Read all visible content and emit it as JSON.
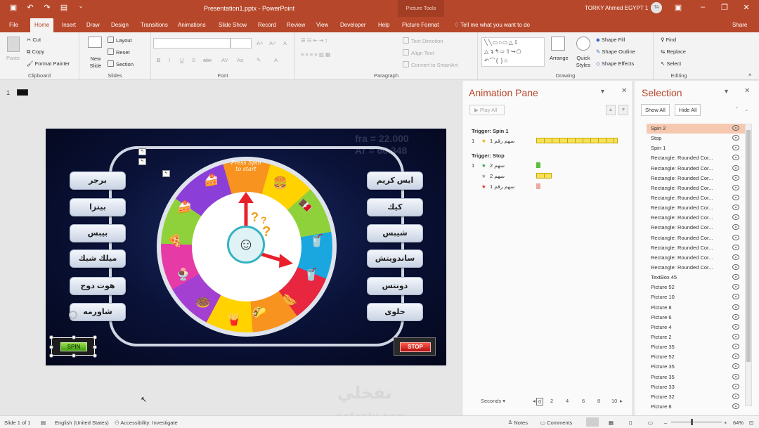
{
  "titlebar": {
    "document_title": "Presentation1.pptx  -  PowerPoint",
    "context_tab_group": "Picture Tools",
    "user_name": "TORKY Ahmed EGYPT 1",
    "user_initials": "TA",
    "qat_icons": [
      "save-icon",
      "undo-icon",
      "redo-icon",
      "start-from-beginning-icon",
      "customize-icon"
    ],
    "window_buttons": [
      "ribbon-display-icon",
      "minimize-icon",
      "restore-icon",
      "close-icon"
    ]
  },
  "tabs": {
    "items": [
      "File",
      "Home",
      "Insert",
      "Draw",
      "Design",
      "Transitions",
      "Animations",
      "Slide Show",
      "Record",
      "Review",
      "View",
      "Developer",
      "Help",
      "Picture Format"
    ],
    "active": "Home",
    "tell_me": "Tell me what you want to do",
    "share": "Share"
  },
  "ribbon": {
    "clipboard": {
      "paste": "Paste",
      "cut": "Cut",
      "copy": "Copy",
      "format_painter": "Format Painter",
      "label": "Clipboard"
    },
    "slides": {
      "new_slide": "New Slide",
      "layout": "Layout",
      "reset": "Reset",
      "section": "Section",
      "label": "Slides"
    },
    "font": {
      "label": "Font",
      "font_name_value": "",
      "font_size_value": "",
      "format_buttons": [
        "B",
        "I",
        "U",
        "S",
        "abc",
        "AV",
        "Aa"
      ]
    },
    "paragraph": {
      "text_direction": "Text Direction",
      "align_text": "Align Text",
      "convert_smartart": "Convert to SmartArt",
      "label": "Paragraph"
    },
    "drawing": {
      "arrange": "Arrange",
      "quick_styles": "Quick Styles",
      "shape_fill": "Shape Fill",
      "shape_outline": "Shape Outline",
      "shape_effects": "Shape Effects",
      "label": "Drawing"
    },
    "editing": {
      "find": "Find",
      "replace": "Replace",
      "select": "Select",
      "label": "Editing"
    }
  },
  "thumbnails": {
    "slide_number": "1"
  },
  "slide": {
    "press_to_start": "Press Spin to start",
    "left_options": [
      "برجر",
      "بيتزا",
      "بيبس",
      "ميلك شيك",
      "هوت دوج",
      "شاورمه"
    ],
    "right_options": [
      "ايس كريم",
      "كيك",
      "شيبس",
      "ساندويتش",
      "دونتس",
      "حلوى"
    ],
    "spin_label": "SPIN",
    "stop_label": "STOP",
    "bg_text": "fra = 22.000\nAr = 60.348",
    "foods": [
      "🍰",
      "🍔",
      "🍫",
      "🥤",
      "🥤",
      "🌭",
      "🌮",
      "🍟",
      "🍩",
      "🍨",
      "🍕",
      "🍰"
    ]
  },
  "animation_pane": {
    "title": "Animation Pane",
    "play_all": "Play All",
    "triggers": [
      {
        "label": "Trigger: Spin 1",
        "rows": [
          {
            "num": "1",
            "name": "سهم رقم 1",
            "star": "green"
          }
        ]
      },
      {
        "label": "Trigger: Stop",
        "rows": [
          {
            "num": "1",
            "name": "سهم 2",
            "star": "green"
          },
          {
            "num": "",
            "name": "سهم 2",
            "star": "gray"
          },
          {
            "num": "",
            "name": "سهم رقم 1",
            "star": "red"
          }
        ]
      }
    ],
    "timeline_unit": "Seconds",
    "timeline_ticks": [
      "0",
      "2",
      "4",
      "6",
      "8",
      "10"
    ]
  },
  "selection_pane": {
    "title": "Selection",
    "show_all": "Show All",
    "hide_all": "Hide All",
    "items": [
      "Spin 2",
      "Stop",
      "Spin 1",
      "Rectangle: Rounded Cor...",
      "Rectangle: Rounded Cor...",
      "Rectangle: Rounded Cor...",
      "Rectangle: Rounded Cor...",
      "Rectangle: Rounded Cor...",
      "Rectangle: Rounded Cor...",
      "Rectangle: Rounded Cor...",
      "Rectangle: Rounded Cor...",
      "Rectangle: Rounded Cor...",
      "Rectangle: Rounded Cor...",
      "Rectangle: Rounded Cor...",
      "Rectangle: Rounded Cor...",
      "TextBox 45",
      "Picture 52",
      "Picture 10",
      "Picture 8",
      "Picture 6",
      "Picture 4",
      "Picture 2",
      "Picture 35",
      "Picture 52",
      "Picture 35",
      "Picture 35",
      "Picture 33",
      "Picture 32",
      "Picture 8"
    ],
    "selected_index": 0
  },
  "status": {
    "slide_info": "Slide 1 of 1",
    "language": "English (United States)",
    "accessibility": "Accessibility: Investigate",
    "notes": "Notes",
    "comments": "Comments",
    "zoom": "64%"
  },
  "watermark": {
    "line1": "نفخلي",
    "line2": "nafezly.com"
  },
  "colors": {
    "accent": "#b7472a",
    "selection_highlight": "#f7c8b0"
  }
}
